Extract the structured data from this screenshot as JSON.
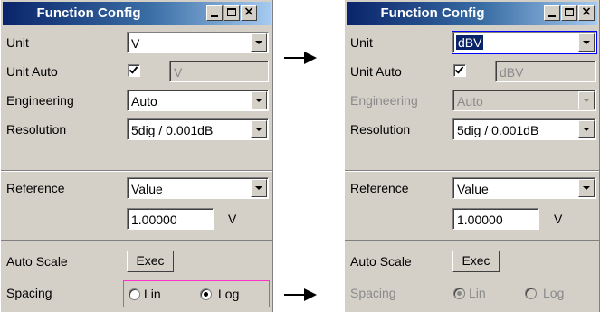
{
  "left": {
    "title": "Function Config",
    "unit": {
      "label": "Unit",
      "value": "V"
    },
    "unit_auto": {
      "label": "Unit Auto",
      "checked": true,
      "value": "V"
    },
    "engineering": {
      "label": "Engineering",
      "value": "Auto"
    },
    "resolution": {
      "label": "Resolution",
      "value": "5dig / 0.001dB"
    },
    "reference": {
      "label": "Reference",
      "value": "Value",
      "number": "1.00000",
      "unit": "V"
    },
    "auto_scale": {
      "label": "Auto Scale",
      "button": "Exec"
    },
    "spacing": {
      "label": "Spacing",
      "options": [
        "Lin",
        "Log"
      ],
      "selected": "Log"
    }
  },
  "right": {
    "title": "Function Config",
    "unit": {
      "label": "Unit",
      "value": "dBV"
    },
    "unit_auto": {
      "label": "Unit Auto",
      "checked": true,
      "value": "dBV"
    },
    "engineering": {
      "label": "Engineering",
      "value": "Auto"
    },
    "resolution": {
      "label": "Resolution",
      "value": "5dig / 0.001dB"
    },
    "reference": {
      "label": "Reference",
      "value": "Value",
      "number": "1.00000",
      "unit": "V"
    },
    "auto_scale": {
      "label": "Auto Scale",
      "button": "Exec"
    },
    "spacing": {
      "label": "Spacing",
      "options": [
        "Lin",
        "Log"
      ],
      "selected": "Lin"
    }
  },
  "icons": {
    "arrow": "arrow-right-icon",
    "minimize": "minimize-icon",
    "maximize": "maximize-icon",
    "close": "close-icon"
  },
  "colors": {
    "title_gradient_start": "#0a246a",
    "title_gradient_end": "#a6caf0",
    "panel": "#d4d0c8",
    "highlight": "#ff33cc"
  }
}
